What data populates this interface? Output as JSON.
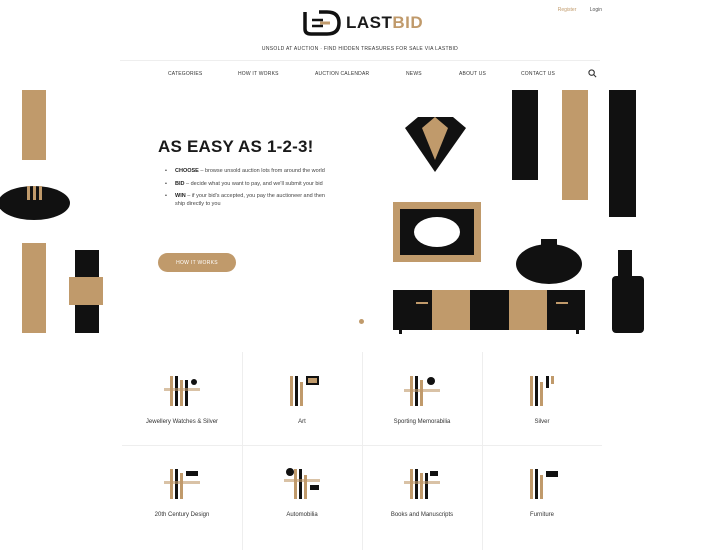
{
  "header": {
    "register_label": "Register",
    "login_label": "Login",
    "logo_text_last": "LAST",
    "logo_text_bid": "BID",
    "tagline": "UNSOLD AT AUCTION · FIND HIDDEN TREASURES FOR SALE VIA LASTBID"
  },
  "nav": {
    "items": [
      "CATEGORIES",
      "HOW IT WORKS",
      "AUCTION CALENDAR",
      "NEWS",
      "ABOUT US",
      "CONTACT US"
    ]
  },
  "hero": {
    "title": "AS EASY AS 1-2-3!",
    "bullets": [
      {
        "head": "CHOOSE",
        "text": " – browse unsold auction lots from around the world"
      },
      {
        "head": "BID",
        "text": " – decide what you want to pay, and we'll submit your bid"
      },
      {
        "head": "WIN",
        "text": " – if your bid's accepted, you pay the auctioneer and then ship directly to you"
      }
    ],
    "cta_label": "HOW IT WORKS"
  },
  "categories": [
    {
      "label": "Jewellery Watches & Silver"
    },
    {
      "label": "Art"
    },
    {
      "label": "Sporting Memorabilia"
    },
    {
      "label": "Silver"
    },
    {
      "label": "20th Century Design"
    },
    {
      "label": "Automobilia"
    },
    {
      "label": "Books and Manuscripts"
    },
    {
      "label": "Furniture"
    }
  ],
  "colors": {
    "brand_gold": "#c09a6b",
    "brand_black": "#111111"
  }
}
